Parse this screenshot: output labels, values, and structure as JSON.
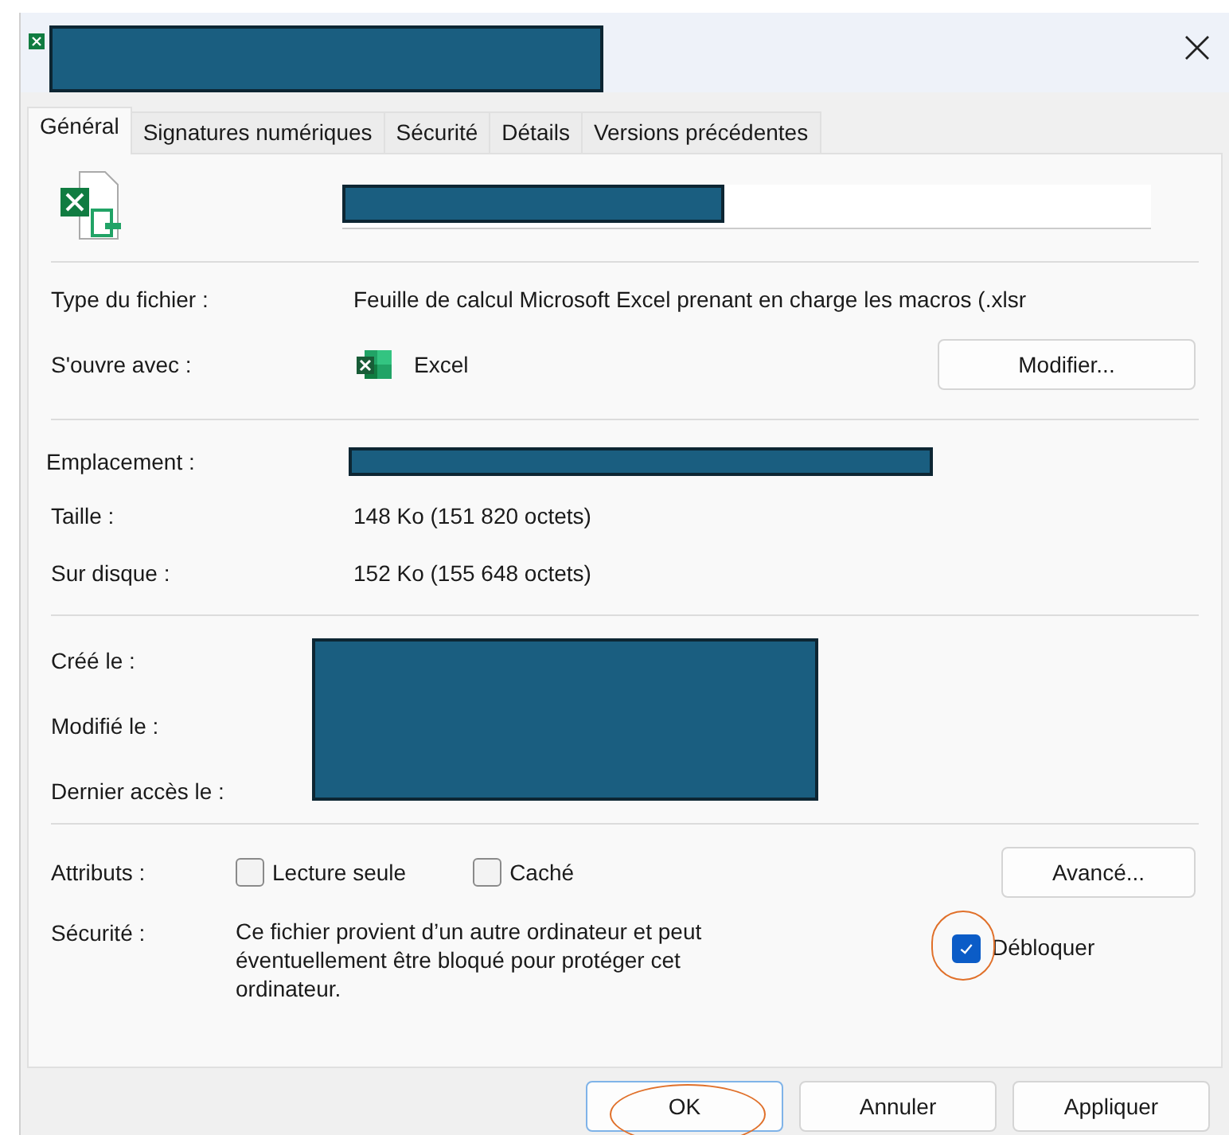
{
  "tabs": [
    {
      "label": "Général",
      "selected": true
    },
    {
      "label": "Signatures numériques",
      "selected": false
    },
    {
      "label": "Sécurité",
      "selected": false
    },
    {
      "label": "Détails",
      "selected": false
    },
    {
      "label": "Versions précédentes",
      "selected": false
    }
  ],
  "file_type": {
    "label": "Type du fichier :",
    "value": "Feuille de calcul Microsoft Excel prenant en charge les macros (.xlsr"
  },
  "opens_with": {
    "label": "S'ouvre avec :",
    "app": "Excel",
    "button": "Modifier..."
  },
  "location": {
    "label": "Emplacement :"
  },
  "size": {
    "label": "Taille :",
    "value": "148 Ko (151 820 octets)"
  },
  "size_on_disk": {
    "label": "Sur disque :",
    "value": "152 Ko (155 648 octets)"
  },
  "dates": [
    {
      "label": "Créé le :"
    },
    {
      "label": "Modifié le :"
    },
    {
      "label": "Dernier accès le :"
    }
  ],
  "attributes": {
    "label": "Attributs :",
    "checkboxes": [
      {
        "label": "Lecture seule",
        "checked": false
      },
      {
        "label": "Caché",
        "checked": false
      }
    ],
    "button": "Avancé..."
  },
  "security": {
    "label": "Sécurité :",
    "text": "Ce fichier provient d’un autre ordinateur et peut éventuellement être bloqué pour protéger cet ordinateur.",
    "unblock": {
      "label": "Débloquer",
      "checked": true
    }
  },
  "buttons": [
    {
      "label": "OK",
      "default": true
    },
    {
      "label": "Annuler",
      "default": false
    },
    {
      "label": "Appliquer",
      "default": false
    }
  ]
}
